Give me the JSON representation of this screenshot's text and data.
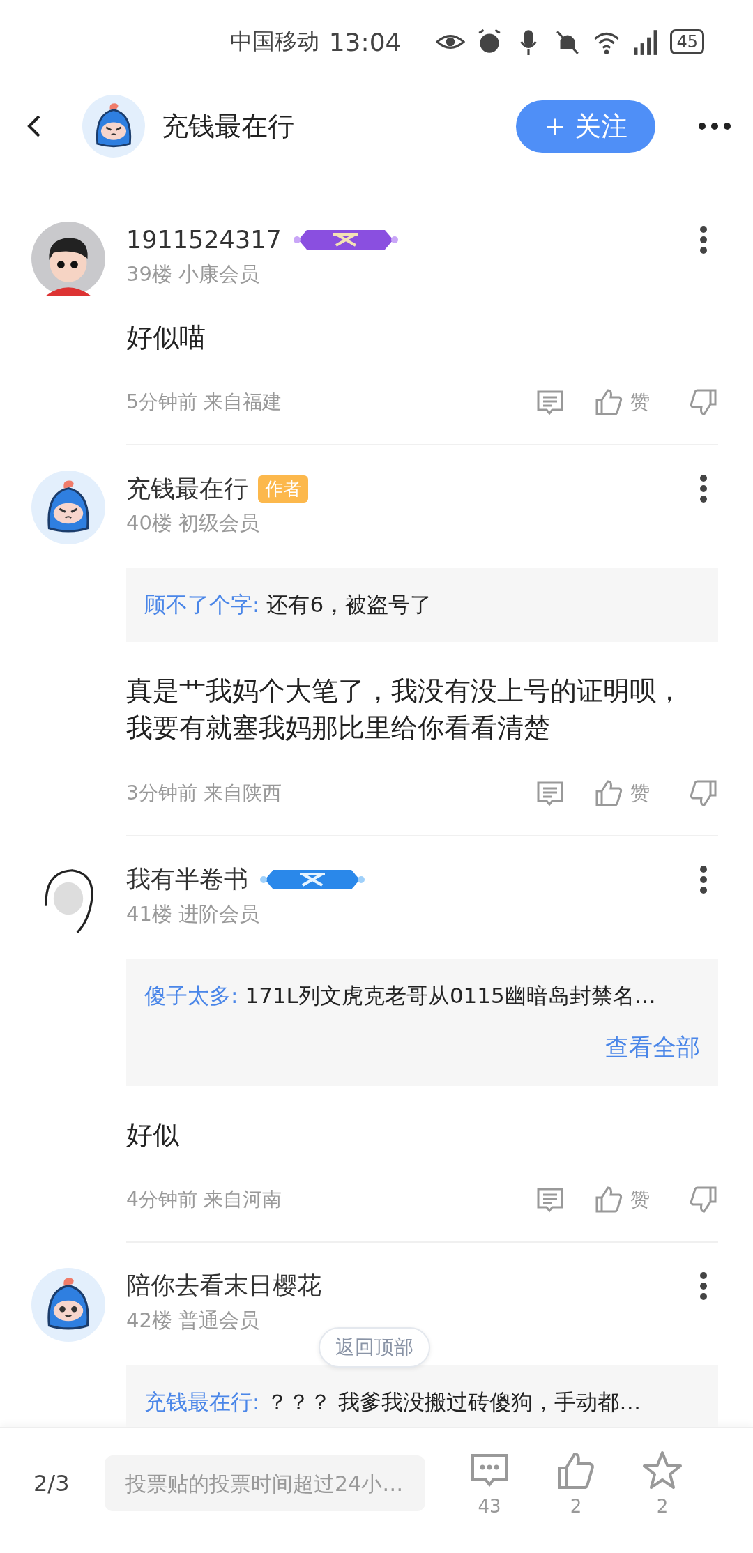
{
  "status_bar": {
    "carrier": "中国移动",
    "time": "13:04",
    "battery": "45"
  },
  "header": {
    "title": "充钱最在行",
    "follow_button": "+ 关注"
  },
  "posts": [
    {
      "avatar": {
        "kind": "boy"
      },
      "user": "1911524317",
      "badge": {
        "kind": "vip_purple"
      },
      "floor": "39楼 小康会员",
      "content": "好似喵",
      "meta": "5分钟前 来自福建",
      "like_label": "赞"
    },
    {
      "avatar": {
        "kind": "mascot_angry"
      },
      "user": "充钱最在行",
      "badge": {
        "kind": "author",
        "text": "作者"
      },
      "floor": "40楼 初级会员",
      "quote": {
        "author": "顾不了个字:",
        "text": "还有6，被盗号了"
      },
      "content": "真是艹我妈个大笔了，我没有没上号的证明呗，我要有就塞我妈那比里给你看看清楚",
      "meta": "3分钟前 来自陕西",
      "like_label": "赞"
    },
    {
      "avatar": {
        "kind": "meme"
      },
      "user": "我有半卷书",
      "badge": {
        "kind": "vip_blue"
      },
      "floor": "41楼 进阶会员",
      "quote": {
        "author": "傻子太多:",
        "text": "171L列文虎克老哥从0115幽暗岛封禁名…",
        "more": "查看全部"
      },
      "content": "好似",
      "meta": "4分钟前 来自河南",
      "like_label": "赞"
    },
    {
      "avatar": {
        "kind": "mascot"
      },
      "user": "陪你去看末日樱花",
      "floor": "42楼 普通会员",
      "quote": {
        "author": "充钱最在行:",
        "text": "？？？ 我爹我没搬过砖傻狗，手动都…"
      }
    }
  ],
  "back_to_top": "返回顶部",
  "bottom_bar": {
    "page": "2/3",
    "placeholder": "投票贴的投票时间超过24小…",
    "comments": "43",
    "likes": "2",
    "favorites": "2"
  }
}
